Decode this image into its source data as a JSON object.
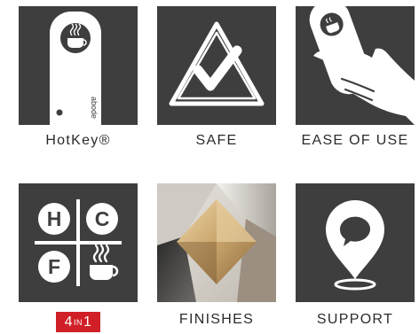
{
  "tiles": [
    {
      "id": "hotkey",
      "label": "HotKey®",
      "icon": "hotkey-tag-icon",
      "tag_text": "abode"
    },
    {
      "id": "safe",
      "label": "SAFE",
      "icon": "warning-check-icon"
    },
    {
      "id": "ease",
      "label": "EASE OF USE",
      "icon": "hand-with-tag-icon"
    },
    {
      "id": "four-in-one",
      "icon": "hcf-grid-icon",
      "letters": {
        "h": "H",
        "c": "C",
        "f": "F"
      },
      "badge": {
        "main": "4",
        "small": "IN",
        "end": "1",
        "color": "#d01f26"
      }
    },
    {
      "id": "finishes",
      "label": "FINISHES",
      "icon": "material-swatches-image"
    },
    {
      "id": "support",
      "label": "SUPPORT",
      "icon": "location-pin-speech-icon"
    }
  ],
  "colors": {
    "tile_bg": "#3e3e3e",
    "icon": "#ffffff",
    "badge_red": "#d01f26",
    "text": "#2b2b2b"
  }
}
